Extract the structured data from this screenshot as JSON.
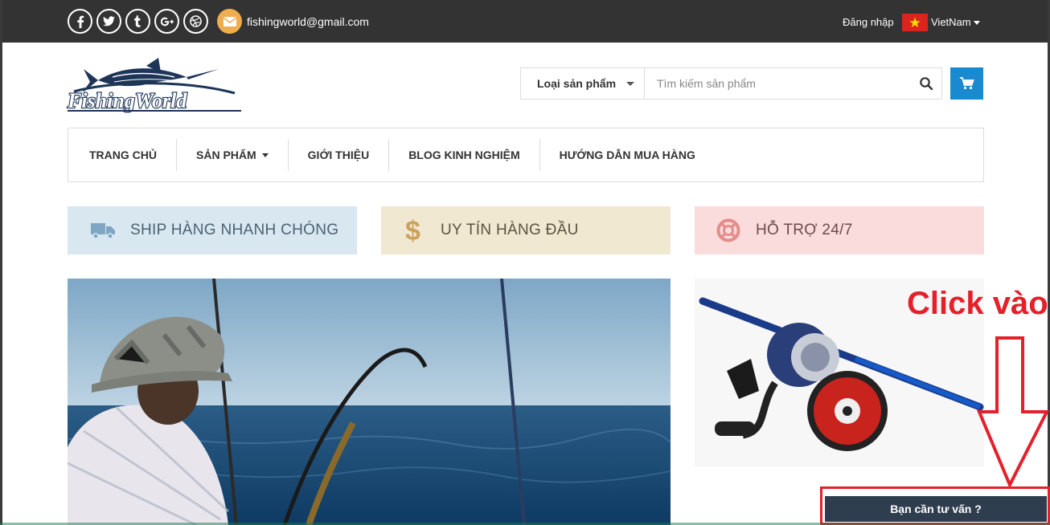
{
  "topbar": {
    "social": [
      {
        "name": "facebook-icon",
        "glyph": "f"
      },
      {
        "name": "twitter-icon",
        "glyph": "t-bird"
      },
      {
        "name": "tumblr-icon",
        "glyph": "t"
      },
      {
        "name": "google-plus-icon",
        "glyph": "g+"
      },
      {
        "name": "dribbble-icon",
        "glyph": "ball"
      }
    ],
    "email": "fishingworld@gmail.com",
    "login": "Đăng nhập",
    "language": "VietNam"
  },
  "logo": {
    "text": "FishingWorld"
  },
  "search": {
    "category_label": "Loại sản phẩm",
    "placeholder": "Tìm kiếm sản phẩm"
  },
  "nav": {
    "items": [
      {
        "label": "TRANG CHỦ"
      },
      {
        "label": "SẢN PHẨM"
      },
      {
        "label": "GIỚI THIỆU"
      },
      {
        "label": "BLOG KINH NGHIỆM"
      },
      {
        "label": "HƯỚNG DẪN MUA HÀNG"
      }
    ]
  },
  "features": {
    "ship": "SHIP HÀNG NHANH CHÓNG",
    "trust": "UY TÍN HÀNG ĐẦU",
    "support": "HỖ TRỢ 24/7"
  },
  "annotation": {
    "click_label": "Click vào"
  },
  "consult": {
    "label": "Bạn cần tư vấn ?"
  },
  "colors": {
    "topbar": "#333333",
    "accent_blue": "#1a8ad0",
    "mail_orange": "#f0ad4e",
    "annotation_red": "#e5202a",
    "consult_bg": "#2f3e4e"
  }
}
